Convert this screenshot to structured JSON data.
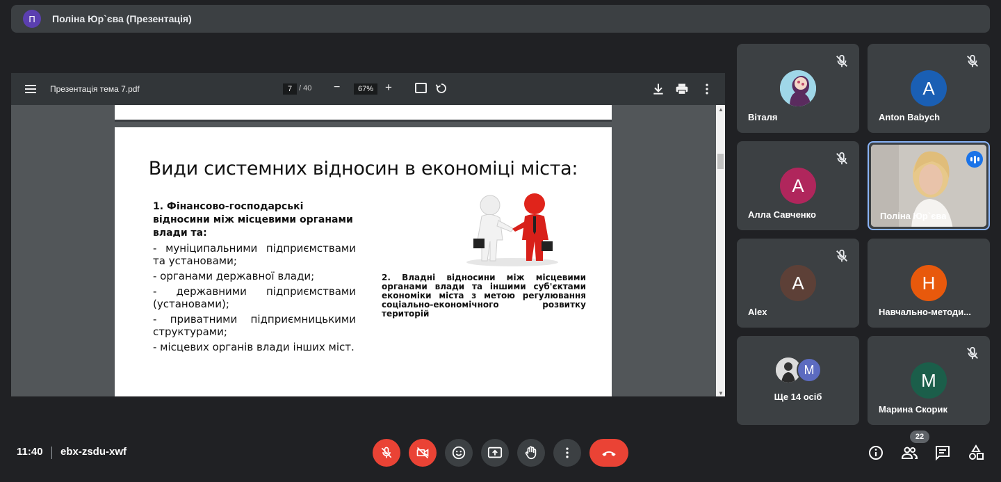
{
  "presenter_bar": {
    "avatar_letter": "П",
    "title": "Поліна Юр`єва (Презентація)"
  },
  "pdf_viewer": {
    "file_name": "Презентація тема 7.pdf",
    "current_page": "7",
    "total_pages": "/ 40",
    "zoom": "67%",
    "zoom_out": "−",
    "zoom_in": "+"
  },
  "slide": {
    "title": "Види системних відносин в економіці міста:",
    "left_heading": "1. Фінансово-господарські відносини між місцевими органами влади та:",
    "left_items": [
      "- муніципальними підприємствами та установами;",
      "- органами державної влади;",
      "- державними підприємствами (установами);",
      "- приватними підприємницькими структурами;",
      "- місцевих органів влади інших міст."
    ],
    "right_text": "2. Владні відносини між місцевими органами влади та іншими суб'єктами економіки міста з метою регулювання соціально-економічного розвитку територій"
  },
  "participants": [
    {
      "name": "Віталя",
      "letter": "",
      "color": "#9fd7e8",
      "muted": true
    },
    {
      "name": "Anton Babych",
      "letter": "A",
      "color": "#1a5fb4",
      "muted": true
    },
    {
      "name": "Алла Савченко",
      "letter": "A",
      "color": "#b0265c",
      "muted": true
    },
    {
      "name": "Поліна Юр`єва",
      "letter": "",
      "color": "#8ab4f8",
      "muted": false,
      "speaking": true
    },
    {
      "name": "Alex",
      "letter": "A",
      "color": "#5d4037",
      "muted": true
    },
    {
      "name": "Навчально-методи...",
      "letter": "Н",
      "color": "#e8590c",
      "muted": false
    },
    {
      "name": "Марина Скорик",
      "letter": "М",
      "color": "#1b5e4a",
      "muted": true
    }
  ],
  "more_tile": {
    "label": "Ще 14 осіб",
    "avatar_letter": "M",
    "avatar_color": "#5c6bc0"
  },
  "bottom_bar": {
    "time": "11:40",
    "meeting_code": "ebx-zsdu-xwf",
    "participant_count": "22"
  },
  "colors": {
    "background": "#202124",
    "tile": "#3c4043",
    "danger": "#ea4335",
    "accent": "#8ab4f8"
  },
  "icons": [
    "mic-off-icon",
    "camera-off-icon",
    "emoji-icon",
    "present-icon",
    "raise-hand-icon",
    "more-icon",
    "hangup-icon",
    "info-icon",
    "people-icon",
    "chat-icon",
    "activities-icon"
  ]
}
